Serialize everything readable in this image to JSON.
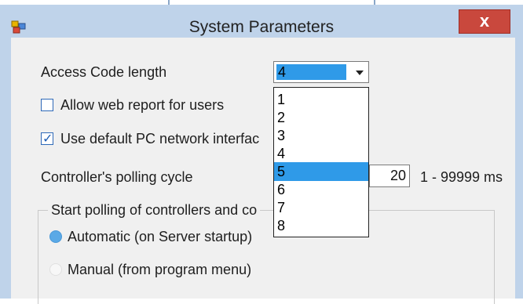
{
  "window": {
    "title": "System Parameters",
    "close_label": "x"
  },
  "access_code": {
    "label": "Access Code length",
    "selected": "4",
    "options": [
      "1",
      "2",
      "3",
      "4",
      "5",
      "6",
      "7",
      "8"
    ],
    "highlighted": "5"
  },
  "allow_web_report": {
    "label": "Allow web report for users",
    "checked": false
  },
  "use_default_nic": {
    "label": "Use default PC network interfac",
    "checked": true
  },
  "polling": {
    "label": "Controller's polling cycle",
    "value": "20",
    "range": "1 - 99999 ms"
  },
  "start_polling": {
    "group_label": "Start polling of controllers and co",
    "options": [
      {
        "label": "Automatic (on Server startup)",
        "selected": true
      },
      {
        "label": "Manual (from program menu)",
        "selected": false
      }
    ]
  },
  "colors": {
    "accent": "#2f9ae8",
    "close": "#c9483d",
    "frame": "#bfd3ea"
  }
}
